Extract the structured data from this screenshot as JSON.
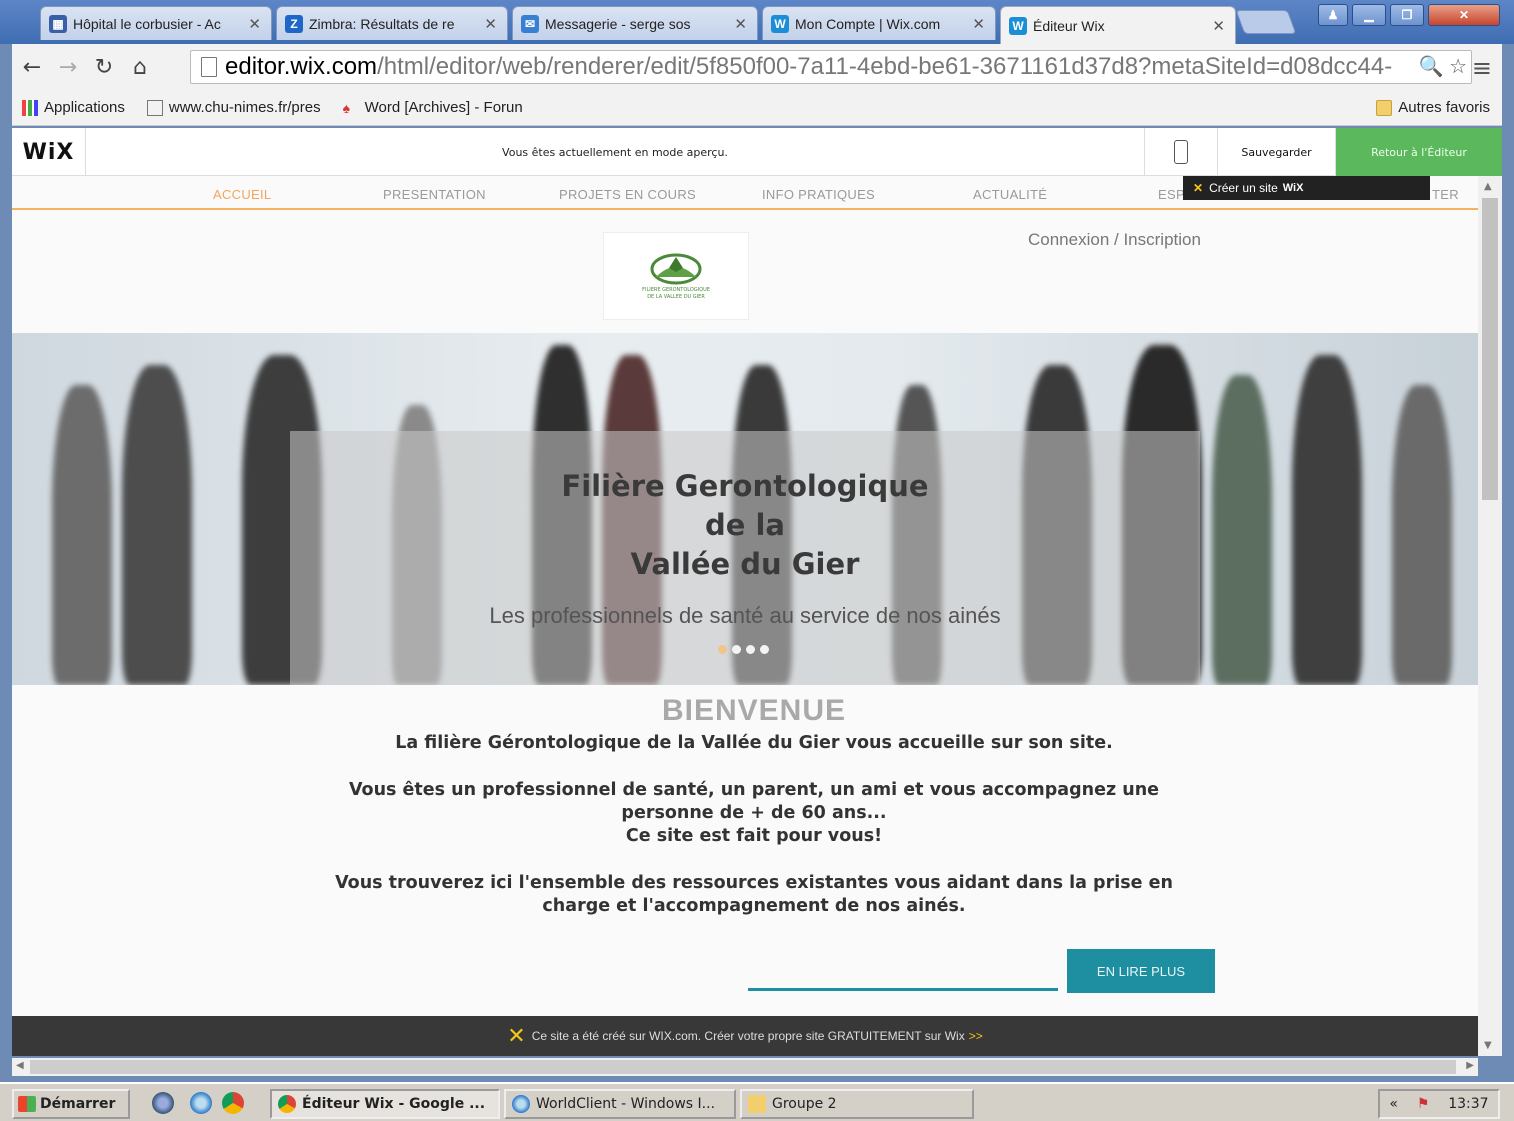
{
  "browser": {
    "tabs": [
      {
        "label": "Hôpital le corbusier - Ac",
        "icon_color": "#3a5fa8",
        "icon_glyph": "▦"
      },
      {
        "label": "Zimbra: Résultats de re",
        "icon_color": "#1e66c8",
        "icon_glyph": "Z"
      },
      {
        "label": "Messagerie - serge sos",
        "icon_color": "#3a80d2",
        "icon_glyph": "✉"
      },
      {
        "label": "Mon Compte | Wix.com",
        "icon_color": "#1a8fd8",
        "icon_glyph": "W"
      },
      {
        "label": "Éditeur Wix",
        "icon_color": "#1a8fd8",
        "icon_glyph": "W"
      }
    ],
    "url_host": "editor.wix.com",
    "url_path": "/html/editor/web/renderer/edit/5f850f00-7a11-4ebd-be61-3671161d37d8?metaSiteId=d08dcc44-",
    "bookmarks": {
      "apps": "Applications",
      "items": [
        "www.chu-nimes.fr/pres",
        "Word [Archives] - Forun"
      ],
      "other": "Autres favoris"
    }
  },
  "wix_bar": {
    "logo": "WiX",
    "preview_message": "Vous êtes actuellement en mode aperçu.",
    "save": "Sauvegarder",
    "back": "Retour à l'Éditeur",
    "promo": "Créer un site",
    "promo_brand": "WiX"
  },
  "site": {
    "nav": [
      "ACCUEIL",
      "PRESENTATION",
      "PROJETS EN COURS",
      "INFO PRATIQUES",
      "ACTUALITÉ",
      "ESP",
      "TER"
    ],
    "login": "Connexion / Inscription",
    "logo_text": [
      "FILIERE GERONTOLOGIQUE",
      "DE LA VALLEE DU GIER"
    ],
    "hero_title_lines": [
      "Filière Gerontologique",
      "de la",
      "Vallée du Gier"
    ],
    "hero_subtitle": "Les professionnels de santé au service de nos ainés",
    "welcome_title": "BIENVENUE",
    "welcome_lines": [
      "La filière Gérontologique de la Vallée du Gier vous accueille sur son site.",
      "Vous êtes un professionnel de santé, un parent, un ami et vous accompagnez une",
      "personne de + de 60 ans...",
      "Ce site est fait pour vous!",
      "Vous trouverez ici l'ensemble des ressources existantes vous aidant dans la prise en",
      "charge et l'accompagnement de nos ainés."
    ],
    "read_more": "EN LIRE PLUS",
    "footer": "Ce site a été créé sur WIX.com. Créer votre propre site GRATUITEMENT sur Wix",
    "footer_arrows": ">>"
  },
  "taskbar": {
    "start": "Démarrer",
    "tasks": [
      "Éditeur Wix - Google ...",
      "WorldClient - Windows I...",
      "Groupe 2"
    ],
    "clock": "13:37",
    "tray_chevron": "«"
  },
  "colors": {
    "accent_green": "#5cb85c",
    "nav_active": "#f0a75a",
    "read_more": "#1e8fa0"
  }
}
